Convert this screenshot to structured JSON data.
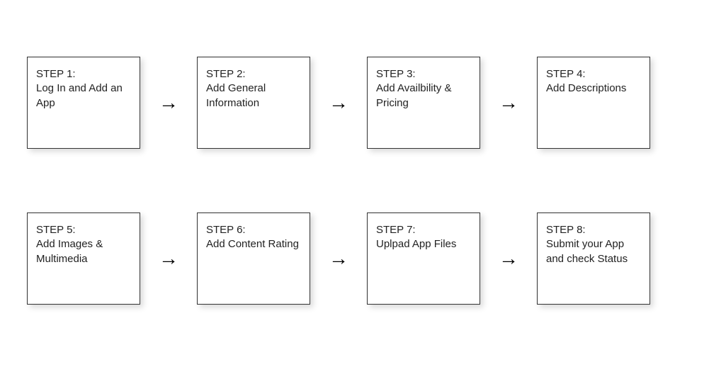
{
  "steps": [
    {
      "label": "STEP 1:",
      "desc": "Log In and Add an App"
    },
    {
      "label": "STEP 2:",
      "desc": "Add General Information"
    },
    {
      "label": "STEP 3:",
      "desc": "Add Availbility & Pricing"
    },
    {
      "label": "STEP 4:",
      "desc": "Add Descriptions"
    },
    {
      "label": "STEP 5:",
      "desc": "Add Images & Multimedia"
    },
    {
      "label": "STEP 6:",
      "desc": "Add Content Rating"
    },
    {
      "label": "STEP 7:",
      "desc": "Uplpad App Files"
    },
    {
      "label": "STEP 8:",
      "desc": "Submit your App and check Status"
    }
  ],
  "arrow_glyph": "→"
}
